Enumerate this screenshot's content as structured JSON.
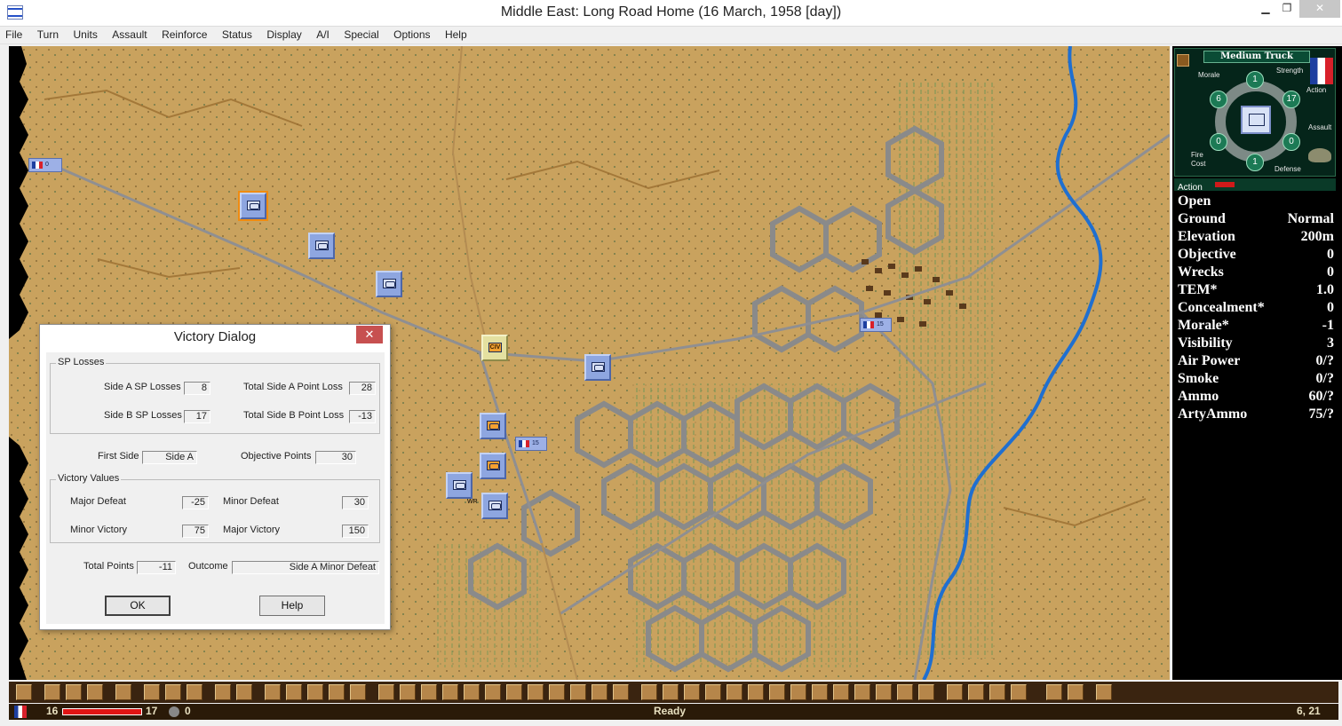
{
  "window": {
    "title": "Middle East: Long Road Home (16 March, 1958 [day])",
    "minimize": "▁",
    "maximize": "❐",
    "close": "✕"
  },
  "menu": [
    "File",
    "Turn",
    "Units",
    "Assault",
    "Reinforce",
    "Status",
    "Display",
    "A/I",
    "Special",
    "Options",
    "Help"
  ],
  "map_labels": {
    "unit_a": "0",
    "unit_b": "15",
    "unit_c": "15",
    "civ": "CIV",
    "wr": "WR"
  },
  "dialog": {
    "title": "Victory Dialog",
    "close": "✕",
    "sp_losses_legend": "SP Losses",
    "side_a_sp_label": "Side A SP Losses",
    "side_a_sp": "8",
    "side_b_sp_label": "Side B SP Losses",
    "side_b_sp": "17",
    "total_a_label": "Total Side A Point Loss",
    "total_a": "28",
    "total_b_label": "Total Side B Point Loss",
    "total_b": "-13",
    "first_side_label": "First Side",
    "first_side": "Side A",
    "objective_label": "Objective Points",
    "objective": "30",
    "victory_legend": "Victory Values",
    "major_defeat_label": "Major Defeat",
    "major_defeat": "-25",
    "minor_defeat_label": "Minor Defeat",
    "minor_defeat": "30",
    "minor_victory_label": "Minor Victory",
    "minor_victory": "75",
    "major_victory_label": "Major Victory",
    "major_victory": "150",
    "total_points_label": "Total Points",
    "total_points": "-11",
    "outcome_label": "Outcome",
    "outcome": "Side A Minor Defeat",
    "ok": "OK",
    "help": "Help"
  },
  "unit_panel": {
    "name": "Medium Truck",
    "morale_label": "Morale",
    "strength_label": "Strength",
    "action_label": "Action",
    "assault_label": "Assault",
    "fire_cost_label": "Fire Cost",
    "defense_label": "Defense",
    "morale": "6",
    "top": "1",
    "strength": "17",
    "fire": "0",
    "assault": "0",
    "bottom": "1",
    "action_bar_label": "Action"
  },
  "terrain": [
    {
      "k": "Open",
      "v": ""
    },
    {
      "k": "Ground",
      "v": "Normal"
    },
    {
      "k": "Elevation",
      "v": "200m"
    },
    {
      "k": "Objective",
      "v": "0"
    },
    {
      "k": "Wrecks",
      "v": "0"
    },
    {
      "k": "TEM*",
      "v": "1.0"
    },
    {
      "k": "Concealment*",
      "v": "0"
    },
    {
      "k": "Morale*",
      "v": "-1"
    },
    {
      "k": "Visibility",
      "v": "3"
    },
    {
      "k": "Air Power",
      "v": "0/?"
    },
    {
      "k": "Smoke",
      "v": "0/?"
    },
    {
      "k": "Ammo",
      "v": "60/?"
    },
    {
      "k": "ArtyAmmo",
      "v": "75/?"
    }
  ],
  "status": {
    "left_value": "16",
    "right_value": "17",
    "extra": "0",
    "center": "Ready",
    "coords": "6, 21"
  },
  "colors": {
    "terrain": "#c9a25e",
    "hex_grid": "#8a8a8a",
    "river": "#1f6fd0",
    "road": "#8f8f92",
    "unit": "#8ea6e0"
  }
}
